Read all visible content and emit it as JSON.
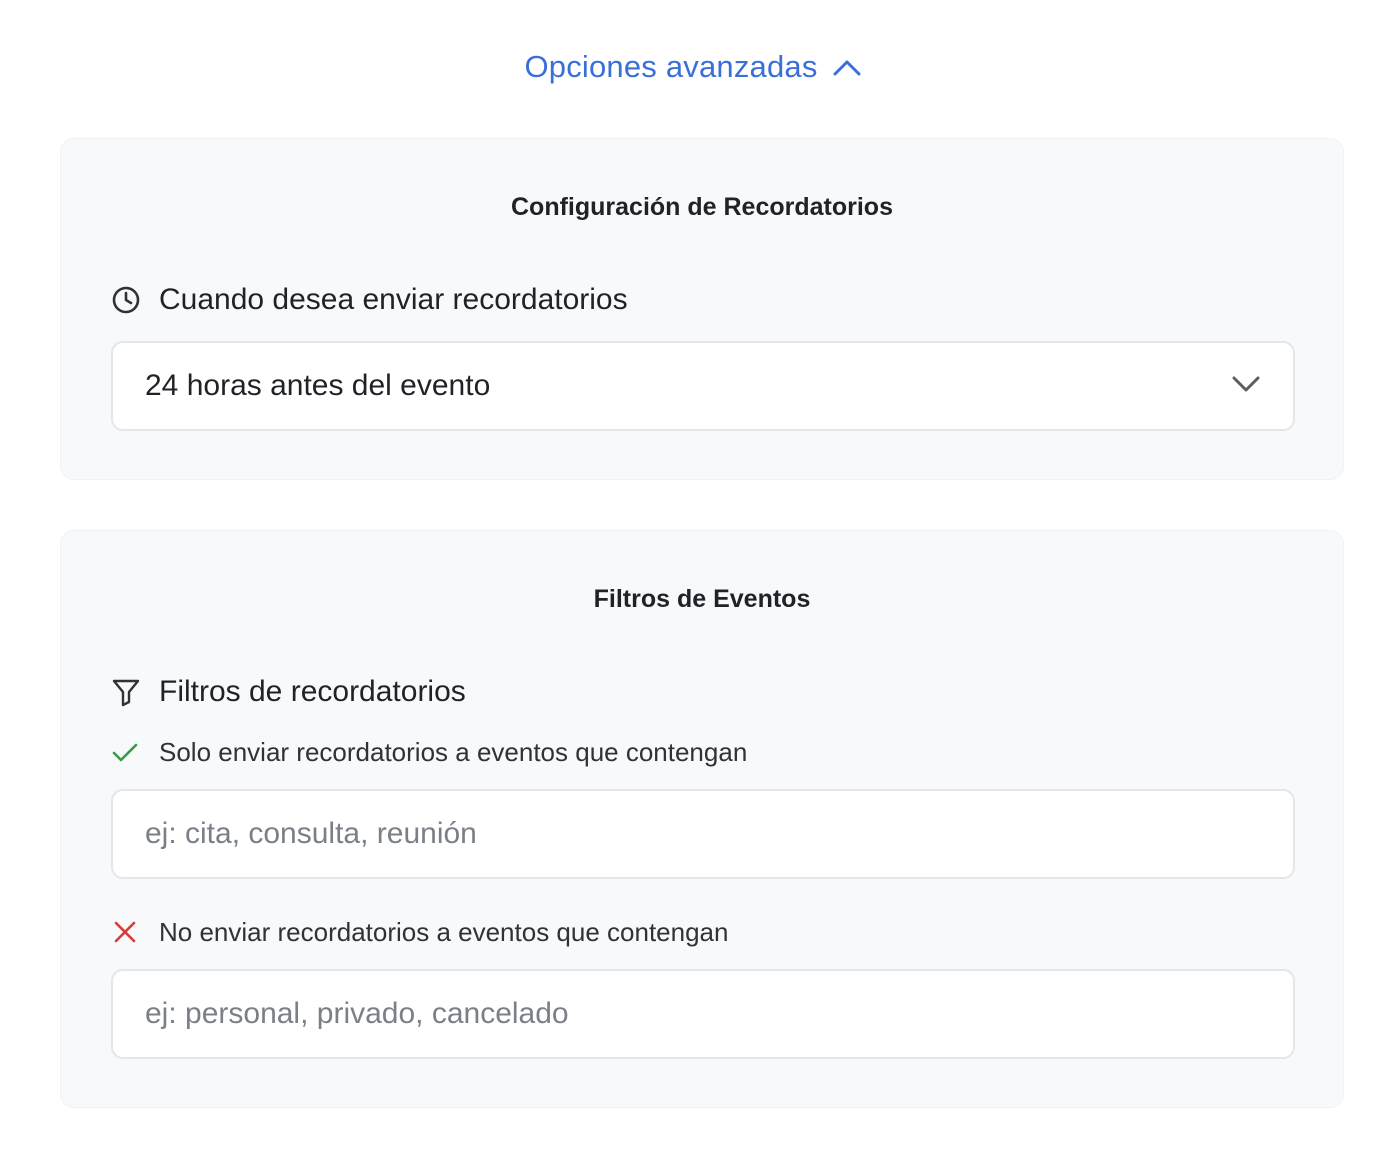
{
  "advanced": {
    "label": "Opciones avanzadas",
    "icon": "chevron-up-icon",
    "color": "#3b6fd8"
  },
  "reminders": {
    "title": "Configuración de Recordatorios",
    "when_label": "Cuando desea enviar recordatorios",
    "when_icon": "clock-icon",
    "select_value": "24 horas antes del evento",
    "select_icon": "chevron-down-icon"
  },
  "filters": {
    "title": "Filtros de Eventos",
    "filters_label": "Filtros de recordatorios",
    "filters_icon": "filter-icon",
    "include": {
      "label": "Solo enviar recordatorios a eventos que contengan",
      "icon": "check-icon",
      "color": "#3a9a4a",
      "placeholder": "ej: cita, consulta, reunión",
      "value": ""
    },
    "exclude": {
      "label": "No enviar recordatorios a eventos que contengan",
      "icon": "x-icon",
      "color": "#d93a3a",
      "placeholder": "ej: personal, privado, cancelado",
      "value": ""
    }
  }
}
